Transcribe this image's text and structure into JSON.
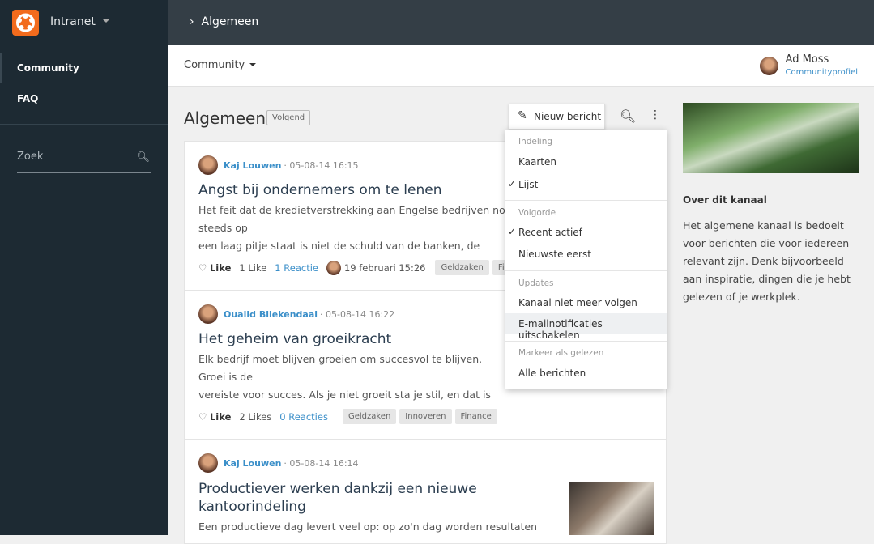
{
  "sidebar": {
    "app_name": "Intranet",
    "items": [
      {
        "label": "Community"
      },
      {
        "label": "FAQ"
      }
    ],
    "search_placeholder": "Zoek"
  },
  "topbar": {
    "breadcrumb": "Algemeen"
  },
  "subheader": {
    "community_menu": "Community",
    "user": {
      "name": "Ad Moss",
      "link": "Communityprofiel"
    }
  },
  "channel": {
    "title": "Algemeen",
    "status": "Volgend",
    "new_post": "Nieuw bericht"
  },
  "posts": [
    {
      "author": "Kaj Louwen",
      "date": "· 05-08-14 16:15",
      "title": "Angst bij ondernemers om te lenen",
      "excerpt": "Het feit dat de kredietverstrekking aan Engelse bedrijven nog steeds op\neen laag pitje staat is niet de schuld van de banken, de bedrijven\ndurven momenteel nog geen financiële...",
      "like": "Like",
      "likes": "1 Like",
      "reactions": "1 Reactie",
      "last_reply": "19 februari 15:26",
      "tags": [
        "Geldzaken",
        "Finance"
      ]
    },
    {
      "author": "Oualid Bliekendaal",
      "date": "· 05-08-14 16:22",
      "title": "Het geheim van groeikracht",
      "excerpt": "Elk bedrijf moet blijven groeien om succesvol te blijven. Groei is de\nvereiste voor succes. Als je niet groeit sta je stil, en dat is vooral in deze\ntijd een bedreiging voor jouw bedrijf. Ook als je...",
      "like": "Like",
      "likes": "2 Likes",
      "reactions": "0 Reacties",
      "tags": [
        "Geldzaken",
        "Innoveren",
        "Finance"
      ]
    },
    {
      "author": "Kaj Louwen",
      "date": "· 05-08-14 16:14",
      "title": "Productiever werken dankzij een nieuwe kantoorindeling",
      "excerpt": "Een productieve dag levert veel op: op zo'n dag worden resultaten"
    }
  ],
  "menu": {
    "sections": [
      {
        "header": "Indeling",
        "items": [
          {
            "label": "Kaarten",
            "checked": false
          },
          {
            "label": "Lijst",
            "checked": true
          }
        ]
      },
      {
        "header": "Volgorde",
        "items": [
          {
            "label": "Recent actief",
            "checked": true
          },
          {
            "label": "Nieuwste eerst",
            "checked": false
          }
        ]
      },
      {
        "header": "Updates",
        "items": [
          {
            "label": "Kanaal niet meer volgen"
          },
          {
            "label": "E-mailnotificaties uitschakelen",
            "hovered": true
          }
        ]
      },
      {
        "header": "Markeer als gelezen",
        "items": [
          {
            "label": "Alle berichten"
          }
        ]
      }
    ]
  },
  "about": {
    "title": "Over dit kanaal",
    "text": "Het algemene kanaal is bedoelt voor berichten die voor iedereen relevant zijn. Denk bijvoorbeeld aan inspiratie, dingen die je hebt gelezen of je werkplek."
  },
  "colors": {
    "accent": "#3b8fc9",
    "logo": "#f26b1d",
    "sidebar": "#1d2a33"
  }
}
